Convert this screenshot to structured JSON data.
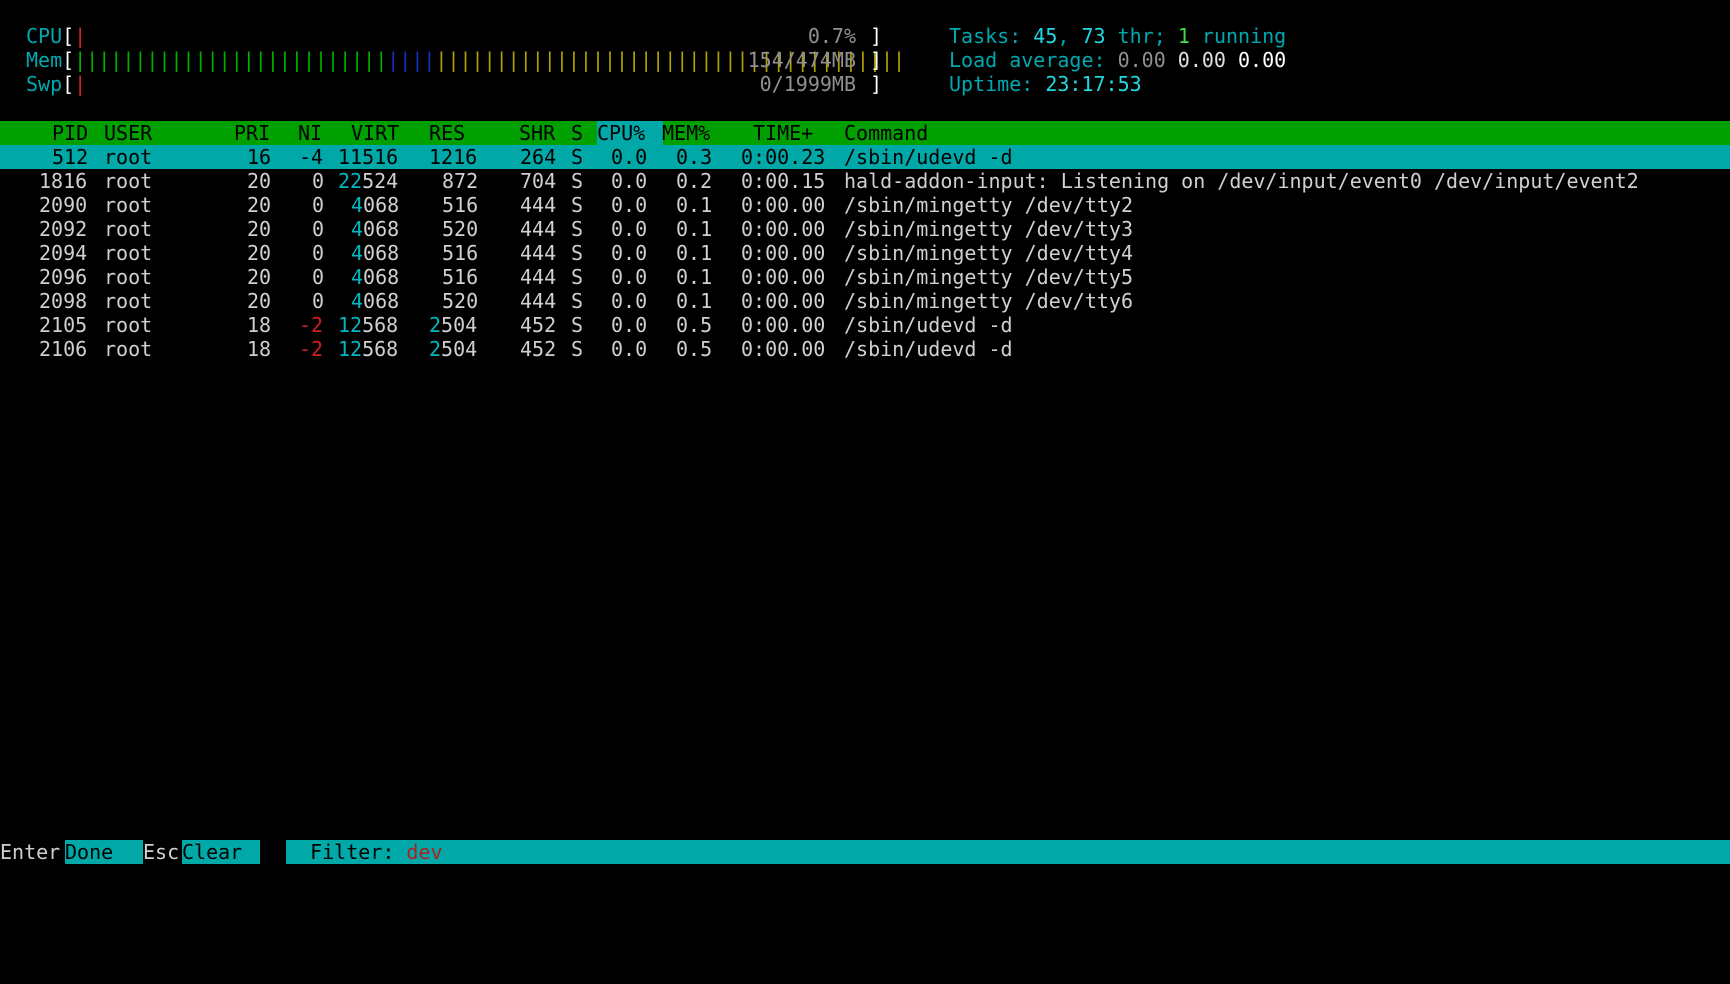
{
  "meters": {
    "cpu": {
      "label": "CPU",
      "bar": "|",
      "value": "0.7%"
    },
    "mem": {
      "label": "Mem",
      "bar_green": "||||||||||||||||||||||||||",
      "bar_blue": "||||",
      "bar_yellow": "|||||||||||||||||||||||||||||||||||||||",
      "value": "154/474MB"
    },
    "swp": {
      "label": "Swp",
      "bar": "|",
      "value": "0/1999MB"
    },
    "tasks": {
      "label": "Tasks: ",
      "count": "45",
      "sep1": ", ",
      "threads": "73",
      "thr_label": " thr; ",
      "running": "1",
      "running_label": " running"
    },
    "load": {
      "label": "Load average: ",
      "l1": "0.00",
      "l5": "0.00",
      "l15": "0.00"
    },
    "uptime": {
      "label": "Uptime: ",
      "value": "23:17:53"
    }
  },
  "header": {
    "pid": "PID",
    "user": "USER",
    "pri": "PRI",
    "ni": "NI",
    "virt": "VIRT",
    "res": "RES",
    "shr": "SHR",
    "s": "S",
    "cpu": "CPU%",
    "mem": "MEM%",
    "time": "TIME+",
    "command": "Command"
  },
  "processes": [
    {
      "pid": "512",
      "user": "root",
      "pri": "16",
      "ni": "-4",
      "virt": "11516",
      "res": "1216",
      "shr": "264",
      "s": "S",
      "cpu": "0.0",
      "mem": "0.3",
      "time": "0:00.23",
      "command": "/sbin/udevd -d"
    },
    {
      "pid": "1816",
      "user": "root",
      "pri": "20",
      "ni": "0",
      "virt": "22524",
      "res": "872",
      "shr": "704",
      "s": "S",
      "cpu": "0.0",
      "mem": "0.2",
      "time": "0:00.15",
      "command": "hald-addon-input: Listening on /dev/input/event0 /dev/input/event2"
    },
    {
      "pid": "2090",
      "user": "root",
      "pri": "20",
      "ni": "0",
      "virt": "4068",
      "res": "516",
      "shr": "444",
      "s": "S",
      "cpu": "0.0",
      "mem": "0.1",
      "time": "0:00.00",
      "command": "/sbin/mingetty /dev/tty2"
    },
    {
      "pid": "2092",
      "user": "root",
      "pri": "20",
      "ni": "0",
      "virt": "4068",
      "res": "520",
      "shr": "444",
      "s": "S",
      "cpu": "0.0",
      "mem": "0.1",
      "time": "0:00.00",
      "command": "/sbin/mingetty /dev/tty3"
    },
    {
      "pid": "2094",
      "user": "root",
      "pri": "20",
      "ni": "0",
      "virt": "4068",
      "res": "516",
      "shr": "444",
      "s": "S",
      "cpu": "0.0",
      "mem": "0.1",
      "time": "0:00.00",
      "command": "/sbin/mingetty /dev/tty4"
    },
    {
      "pid": "2096",
      "user": "root",
      "pri": "20",
      "ni": "0",
      "virt": "4068",
      "res": "516",
      "shr": "444",
      "s": "S",
      "cpu": "0.0",
      "mem": "0.1",
      "time": "0:00.00",
      "command": "/sbin/mingetty /dev/tty5"
    },
    {
      "pid": "2098",
      "user": "root",
      "pri": "20",
      "ni": "0",
      "virt": "4068",
      "res": "520",
      "shr": "444",
      "s": "S",
      "cpu": "0.0",
      "mem": "0.1",
      "time": "0:00.00",
      "command": "/sbin/mingetty /dev/tty6"
    },
    {
      "pid": "2105",
      "user": "root",
      "pri": "18",
      "ni": "-2",
      "virt": "12568",
      "res": "2504",
      "shr": "452",
      "s": "S",
      "cpu": "0.0",
      "mem": "0.5",
      "time": "0:00.00",
      "command": "/sbin/udevd -d"
    },
    {
      "pid": "2106",
      "user": "root",
      "pri": "18",
      "ni": "-2",
      "virt": "12568",
      "res": "2504",
      "shr": "452",
      "s": "S",
      "cpu": "0.0",
      "mem": "0.5",
      "time": "0:00.00",
      "command": "/sbin/udevd -d"
    }
  ],
  "footer": {
    "enter_key": "Enter",
    "done_label": "Done  ",
    "esc_key": "Esc",
    "clear_label": "Clear  ",
    "filter_label": "  Filter: ",
    "filter_value": "dev"
  },
  "colors": {
    "header_bg": "#00a000",
    "selection_bg": "#00a8a8",
    "accent": "#00a8b0"
  }
}
